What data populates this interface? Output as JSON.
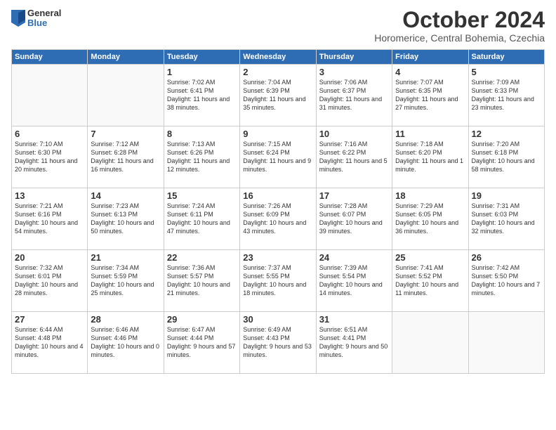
{
  "logo": {
    "general": "General",
    "blue": "Blue"
  },
  "title": "October 2024",
  "location": "Horomerice, Central Bohemia, Czechia",
  "days_header": [
    "Sunday",
    "Monday",
    "Tuesday",
    "Wednesday",
    "Thursday",
    "Friday",
    "Saturday"
  ],
  "weeks": [
    [
      {
        "day": "",
        "info": ""
      },
      {
        "day": "",
        "info": ""
      },
      {
        "day": "1",
        "info": "Sunrise: 7:02 AM\nSunset: 6:41 PM\nDaylight: 11 hours and 38 minutes."
      },
      {
        "day": "2",
        "info": "Sunrise: 7:04 AM\nSunset: 6:39 PM\nDaylight: 11 hours and 35 minutes."
      },
      {
        "day": "3",
        "info": "Sunrise: 7:06 AM\nSunset: 6:37 PM\nDaylight: 11 hours and 31 minutes."
      },
      {
        "day": "4",
        "info": "Sunrise: 7:07 AM\nSunset: 6:35 PM\nDaylight: 11 hours and 27 minutes."
      },
      {
        "day": "5",
        "info": "Sunrise: 7:09 AM\nSunset: 6:33 PM\nDaylight: 11 hours and 23 minutes."
      }
    ],
    [
      {
        "day": "6",
        "info": "Sunrise: 7:10 AM\nSunset: 6:30 PM\nDaylight: 11 hours and 20 minutes."
      },
      {
        "day": "7",
        "info": "Sunrise: 7:12 AM\nSunset: 6:28 PM\nDaylight: 11 hours and 16 minutes."
      },
      {
        "day": "8",
        "info": "Sunrise: 7:13 AM\nSunset: 6:26 PM\nDaylight: 11 hours and 12 minutes."
      },
      {
        "day": "9",
        "info": "Sunrise: 7:15 AM\nSunset: 6:24 PM\nDaylight: 11 hours and 9 minutes."
      },
      {
        "day": "10",
        "info": "Sunrise: 7:16 AM\nSunset: 6:22 PM\nDaylight: 11 hours and 5 minutes."
      },
      {
        "day": "11",
        "info": "Sunrise: 7:18 AM\nSunset: 6:20 PM\nDaylight: 11 hours and 1 minute."
      },
      {
        "day": "12",
        "info": "Sunrise: 7:20 AM\nSunset: 6:18 PM\nDaylight: 10 hours and 58 minutes."
      }
    ],
    [
      {
        "day": "13",
        "info": "Sunrise: 7:21 AM\nSunset: 6:16 PM\nDaylight: 10 hours and 54 minutes."
      },
      {
        "day": "14",
        "info": "Sunrise: 7:23 AM\nSunset: 6:13 PM\nDaylight: 10 hours and 50 minutes."
      },
      {
        "day": "15",
        "info": "Sunrise: 7:24 AM\nSunset: 6:11 PM\nDaylight: 10 hours and 47 minutes."
      },
      {
        "day": "16",
        "info": "Sunrise: 7:26 AM\nSunset: 6:09 PM\nDaylight: 10 hours and 43 minutes."
      },
      {
        "day": "17",
        "info": "Sunrise: 7:28 AM\nSunset: 6:07 PM\nDaylight: 10 hours and 39 minutes."
      },
      {
        "day": "18",
        "info": "Sunrise: 7:29 AM\nSunset: 6:05 PM\nDaylight: 10 hours and 36 minutes."
      },
      {
        "day": "19",
        "info": "Sunrise: 7:31 AM\nSunset: 6:03 PM\nDaylight: 10 hours and 32 minutes."
      }
    ],
    [
      {
        "day": "20",
        "info": "Sunrise: 7:32 AM\nSunset: 6:01 PM\nDaylight: 10 hours and 28 minutes."
      },
      {
        "day": "21",
        "info": "Sunrise: 7:34 AM\nSunset: 5:59 PM\nDaylight: 10 hours and 25 minutes."
      },
      {
        "day": "22",
        "info": "Sunrise: 7:36 AM\nSunset: 5:57 PM\nDaylight: 10 hours and 21 minutes."
      },
      {
        "day": "23",
        "info": "Sunrise: 7:37 AM\nSunset: 5:55 PM\nDaylight: 10 hours and 18 minutes."
      },
      {
        "day": "24",
        "info": "Sunrise: 7:39 AM\nSunset: 5:54 PM\nDaylight: 10 hours and 14 minutes."
      },
      {
        "day": "25",
        "info": "Sunrise: 7:41 AM\nSunset: 5:52 PM\nDaylight: 10 hours and 11 minutes."
      },
      {
        "day": "26",
        "info": "Sunrise: 7:42 AM\nSunset: 5:50 PM\nDaylight: 10 hours and 7 minutes."
      }
    ],
    [
      {
        "day": "27",
        "info": "Sunrise: 6:44 AM\nSunset: 4:48 PM\nDaylight: 10 hours and 4 minutes."
      },
      {
        "day": "28",
        "info": "Sunrise: 6:46 AM\nSunset: 4:46 PM\nDaylight: 10 hours and 0 minutes."
      },
      {
        "day": "29",
        "info": "Sunrise: 6:47 AM\nSunset: 4:44 PM\nDaylight: 9 hours and 57 minutes."
      },
      {
        "day": "30",
        "info": "Sunrise: 6:49 AM\nSunset: 4:43 PM\nDaylight: 9 hours and 53 minutes."
      },
      {
        "day": "31",
        "info": "Sunrise: 6:51 AM\nSunset: 4:41 PM\nDaylight: 9 hours and 50 minutes."
      },
      {
        "day": "",
        "info": ""
      },
      {
        "day": "",
        "info": ""
      }
    ]
  ]
}
